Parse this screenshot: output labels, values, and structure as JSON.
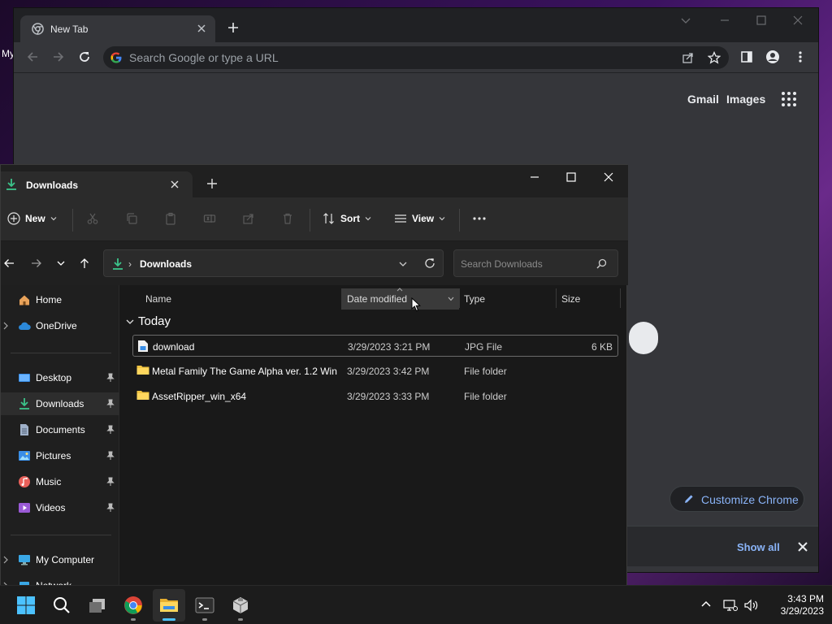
{
  "desktop": {
    "fragment_text": "My"
  },
  "chrome": {
    "tab_title": "New Tab",
    "omnibox_placeholder": "Search Google or type a URL",
    "links": {
      "gmail": "Gmail",
      "images": "Images"
    },
    "customize_label": "Customize Chrome",
    "download_bar": {
      "show_all": "Show all"
    }
  },
  "explorer": {
    "tab_title": "Downloads",
    "commands": {
      "new": "New",
      "sort": "Sort",
      "view": "View"
    },
    "address": {
      "location": "Downloads",
      "separator": "›"
    },
    "search_placeholder": "Search Downloads",
    "nav": [
      {
        "label": "Home",
        "icon": "home-icon",
        "pinned": false,
        "expandable": false,
        "selected": false
      },
      {
        "label": "OneDrive",
        "icon": "cloud-icon",
        "pinned": false,
        "expandable": true,
        "selected": false
      },
      {
        "label": "Desktop",
        "icon": "desktop-icon",
        "pinned": true,
        "expandable": false,
        "selected": false
      },
      {
        "label": "Downloads",
        "icon": "download-icon",
        "pinned": true,
        "expandable": false,
        "selected": true
      },
      {
        "label": "Documents",
        "icon": "document-icon",
        "pinned": true,
        "expandable": false,
        "selected": false
      },
      {
        "label": "Pictures",
        "icon": "picture-icon",
        "pinned": true,
        "expandable": false,
        "selected": false
      },
      {
        "label": "Music",
        "icon": "music-icon",
        "pinned": true,
        "expandable": false,
        "selected": false
      },
      {
        "label": "Videos",
        "icon": "video-icon",
        "pinned": true,
        "expandable": false,
        "selected": false
      },
      {
        "label": "My Computer",
        "icon": "computer-icon",
        "pinned": false,
        "expandable": true,
        "selected": false
      },
      {
        "label": "Network",
        "icon": "network-icon",
        "pinned": false,
        "expandable": true,
        "selected": false
      }
    ],
    "columns": {
      "name": "Name",
      "date": "Date modified",
      "type": "Type",
      "size": "Size"
    },
    "group_label": "Today",
    "files": [
      {
        "name": "download",
        "date": "3/29/2023 3:21 PM",
        "type": "JPG File",
        "size": "6 KB",
        "icon": "image-file-icon"
      },
      {
        "name": "Metal Family The Game Alpha ver. 1.2 Win",
        "date": "3/29/2023 3:42 PM",
        "type": "File folder",
        "size": "",
        "icon": "folder-icon"
      },
      {
        "name": "AssetRipper_win_x64",
        "date": "3/29/2023 3:33 PM",
        "type": "File folder",
        "size": "",
        "icon": "folder-icon"
      }
    ]
  },
  "taskbar": {
    "apps": [
      "start-icon",
      "search-icon",
      "task-view-icon",
      "chrome-icon",
      "file-explorer-icon",
      "terminal-icon",
      "package-icon"
    ],
    "clock": {
      "time": "3:43 PM",
      "date": "3/29/2023"
    }
  },
  "colors": {
    "accent": "#4cc2ff",
    "link": "#8ab4f8",
    "folder": "#f0c341",
    "download_green": "#3cc38a"
  }
}
